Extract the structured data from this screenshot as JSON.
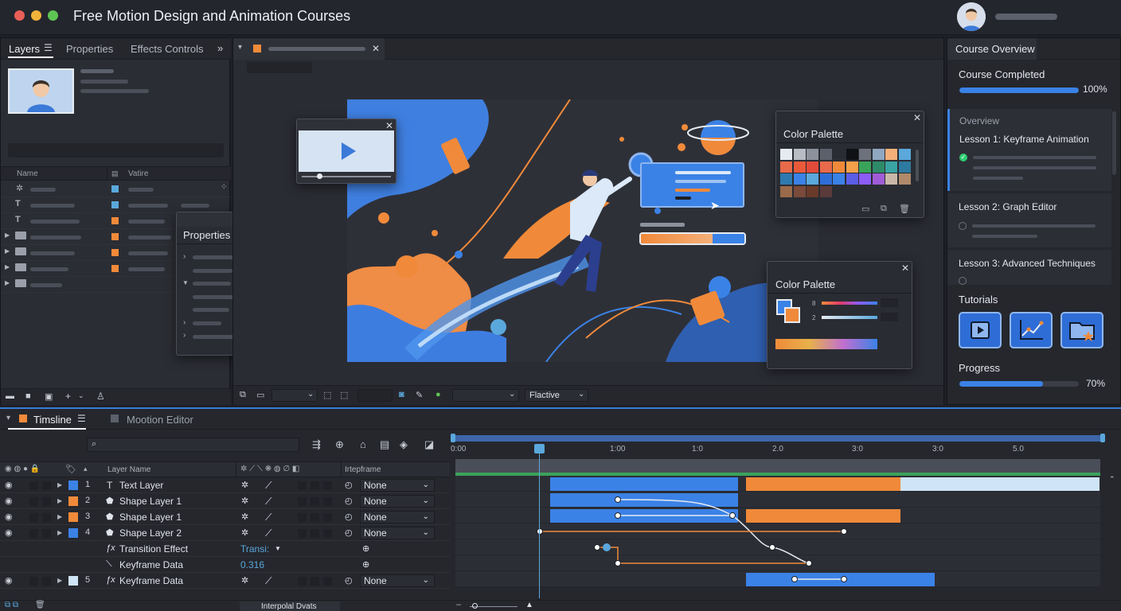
{
  "window": {
    "title": "Free Motion Design and Animation Courses"
  },
  "left_panel": {
    "tabs": [
      "Layers",
      "Properties",
      "Effects Controls"
    ],
    "column_headers": {
      "name": "Name",
      "value": "Vatire"
    },
    "colors": {
      "accent_blue": "#5aa8dc",
      "accent_orange": "#f08a3a"
    }
  },
  "properties_window": {
    "title": "Properties"
  },
  "color_palette_1": {
    "title": "Color Palette"
  },
  "color_palette_2": {
    "title": "Color Palette",
    "values": [
      "8",
      "2"
    ]
  },
  "viewer_toolbar": {
    "dropdown_label": "Flactive"
  },
  "right_panel": {
    "tab": "Course Overview",
    "course_completed_label": "Course Completed",
    "course_completed_value": "100%",
    "course_completed_fraction": 1.0,
    "overview_label": "Overview",
    "lessons": [
      {
        "title": "Lesson 1: Keyframe Animation",
        "status": "completed"
      },
      {
        "title": "Lesson 2: Graph Editor",
        "status": "pending"
      },
      {
        "title": "Lesson 3: Advanced Techniques",
        "status": "pending"
      }
    ],
    "tutorials_label": "Tutorials",
    "tutorial_icons": [
      "play-icon",
      "graph-icon",
      "folder-star-icon"
    ],
    "progress_label": "Progress",
    "progress_value": "70%",
    "progress_fraction": 0.7
  },
  "timeline": {
    "tabs": [
      "Timsline",
      "Mootion Editor"
    ],
    "columns": {
      "layer_name": "Layer Name",
      "interpolation": "Irtepframe"
    },
    "ruler": [
      "0:00",
      "1:00",
      "1:0",
      "2.0",
      "3:0",
      "3:0",
      "5.0"
    ],
    "layers": [
      {
        "num": "1",
        "name": "Text Layer",
        "color": "#3b82e6",
        "interp": "None"
      },
      {
        "num": "2",
        "name": "Shape Layer 1",
        "color": "#f08a3a",
        "interp": "None"
      },
      {
        "num": "3",
        "name": "Shape Layer 1",
        "color": "#f08a3a",
        "interp": "None"
      },
      {
        "num": "4",
        "name": "Shape Layer 2",
        "color": "#3b82e6",
        "interp": "None"
      },
      {
        "name": "Transition Effect",
        "value": "Transi:"
      },
      {
        "name": "Keyframe Data",
        "value": "0.316"
      },
      {
        "num": "5",
        "name": "Keyframe Data",
        "color": "#cfe4f7",
        "interp": "None"
      }
    ],
    "footer_label": "Interpolal Dvats"
  }
}
